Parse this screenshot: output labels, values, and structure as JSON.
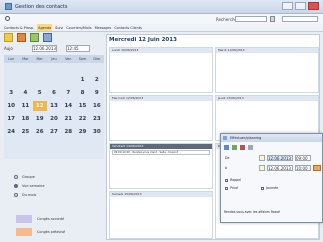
{
  "window": {
    "title": "Gestion des contacts"
  },
  "search": {
    "label": "Recherche",
    "value": "",
    "extra_value": ""
  },
  "menu": {
    "items": [
      "Contacts & Prosp.",
      "Agenda",
      "Suivi",
      "Courriers/Mails",
      "Messages",
      "Contacts Clients"
    ],
    "active_index": 1
  },
  "toolbar": {
    "icons": [
      "calendar-icon",
      "clock-icon",
      "people-icon",
      "notes-icon"
    ]
  },
  "nav": {
    "today_label": "Aujo",
    "date_value": "12.06.2013",
    "time_value": "12:45"
  },
  "calendar": {
    "weekdays": [
      "Lun",
      "Mar",
      "Mer",
      "Jeu",
      "Ven",
      "Sam",
      "Dim"
    ],
    "days": [
      "",
      "",
      "",
      "",
      "",
      "1",
      "2",
      "3",
      "4",
      "5",
      "6",
      "7",
      "8",
      "9",
      "10",
      "11",
      "12",
      "13",
      "14",
      "15",
      "16",
      "17",
      "18",
      "19",
      "20",
      "21",
      "22",
      "23",
      "24",
      "25",
      "26",
      "27",
      "28",
      "29",
      "30"
    ],
    "today": "12"
  },
  "view_options": [
    {
      "label": "Groupe",
      "selected": false
    },
    {
      "label": "Vue semaine",
      "selected": true
    },
    {
      "label": "Du mois",
      "selected": false
    }
  ],
  "legend": [
    {
      "label": "Congés accordé",
      "color": "#c9c4ea"
    },
    {
      "label": "Congés préavisé",
      "color": "#f5b98a"
    }
  ],
  "main": {
    "date_header": "Mercredi 12 Juin 2013",
    "days": [
      {
        "label": "Lundi 10/06/2013",
        "entries": [],
        "dark": false
      },
      {
        "label": "Mardi 11/06/2013",
        "entries": [],
        "dark": false
      },
      {
        "label": "Mercredi 12/06/2013",
        "entries": [],
        "dark": false
      },
      {
        "label": "Jeudi 13/06/2013",
        "entries": [],
        "dark": false
      },
      {
        "label": "Vendredi 14/06/2013",
        "entries": [
          "09:00-10:00 - Rendez-vous client - Salle - Dupont"
        ],
        "dark": true
      },
      {
        "label": "Samedi 15/06/2013",
        "entries": [],
        "dark": false
      },
      {
        "label": "Dimanche 16/06/2013",
        "entries": [],
        "dark": false
      }
    ]
  },
  "popup": {
    "title": "Effectuer/planning",
    "de_label": "De",
    "a_label": "à",
    "date_from": "12.06.2013",
    "date_to": "12.06.2013",
    "time_from": "09:00",
    "time_to": "10:00",
    "check1": "Rappel",
    "check2": "Privé",
    "check3": "Journée",
    "note": "Rendez-vous avec les affaires Rossé"
  },
  "colors": {
    "accent": "#f3b64a",
    "header_blue": "#1d3e73",
    "window_bg": "#e9eef5",
    "congé_accordé": "#c9c4ea",
    "congé_préavisé": "#f5b98a"
  }
}
